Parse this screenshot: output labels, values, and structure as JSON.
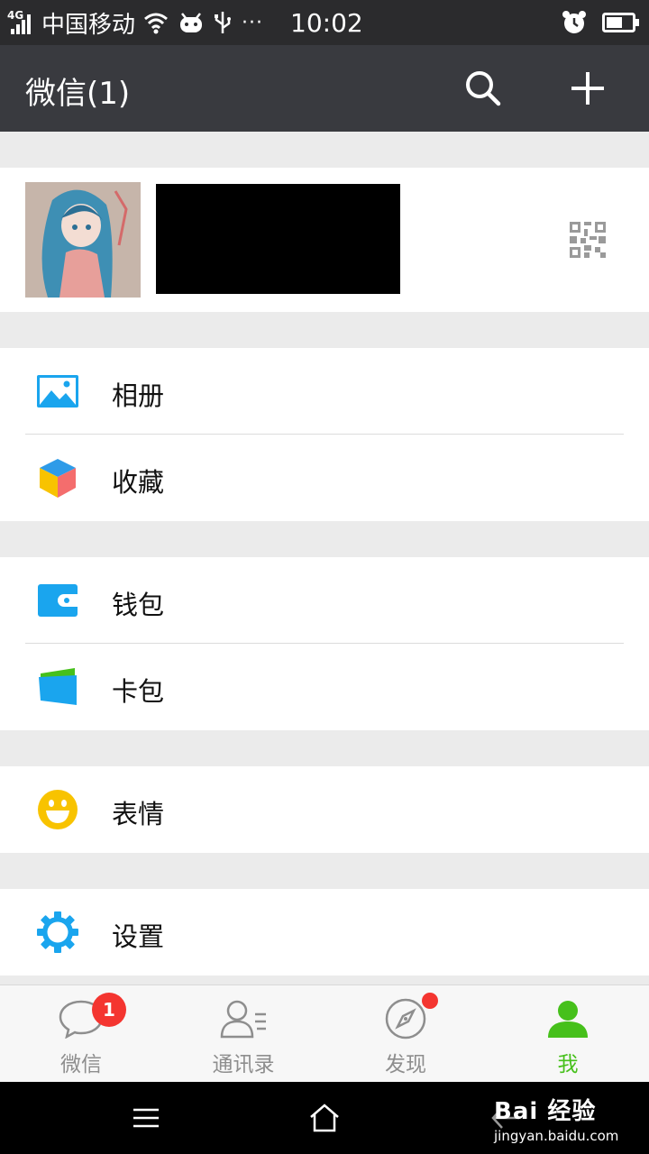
{
  "status_bar": {
    "network": "4G",
    "carrier": "中国移动",
    "dots": "···",
    "time": "10:02"
  },
  "header": {
    "title": "微信(1)"
  },
  "menu": {
    "album": "相册",
    "favorites": "收藏",
    "wallet": "钱包",
    "card_pack": "卡包",
    "stickers": "表情",
    "settings": "设置"
  },
  "tabs": [
    {
      "label": "微信",
      "badge": "1"
    },
    {
      "label": "通讯录"
    },
    {
      "label": "发现"
    },
    {
      "label": "我"
    }
  ],
  "watermark": {
    "brand": "Bai 经验",
    "url": "jingyan.baidu.com"
  },
  "colors": {
    "header_bg": "#393a3f",
    "accent_green": "#46c01b",
    "badge_red": "#f43530",
    "icon_blue": "#1aa5ee",
    "sticker_yellow": "#f8c300"
  },
  "icons": {
    "header": [
      "search-icon",
      "plus-icon"
    ],
    "menu": [
      "album-icon",
      "favorites-icon",
      "wallet-icon",
      "card-pack-icon",
      "sticker-icon",
      "settings-gear-icon"
    ],
    "tabs": [
      "chat-bubble-icon",
      "contacts-icon",
      "compass-icon",
      "person-icon"
    ]
  }
}
